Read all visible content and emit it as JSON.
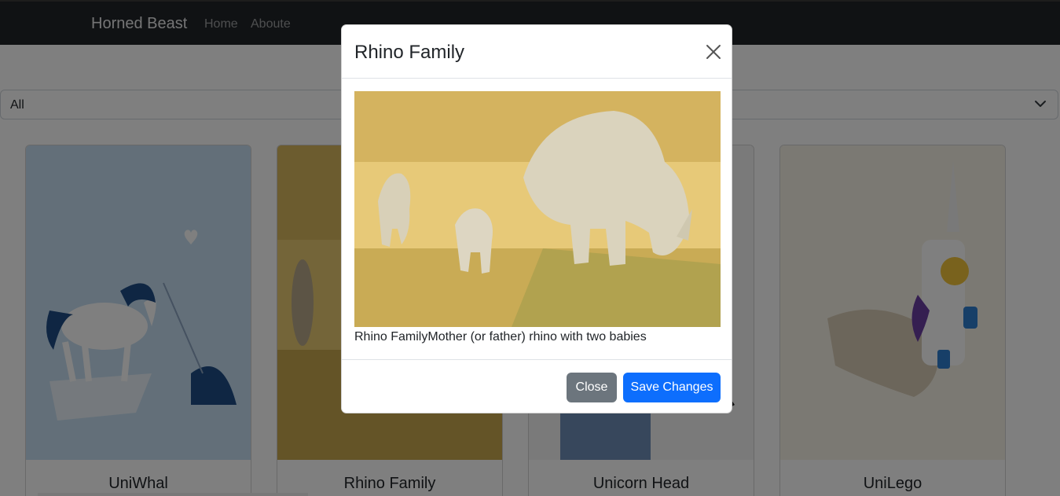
{
  "navbar": {
    "brand": "Horned Beast",
    "links": [
      "Home",
      "Aboute"
    ]
  },
  "filter": {
    "selected": "All"
  },
  "cards": [
    {
      "title": "UniWhal"
    },
    {
      "title": "Rhino Family"
    },
    {
      "title": "Unicorn Head"
    },
    {
      "title": "UniLego"
    }
  ],
  "modal": {
    "title": "Rhino Family",
    "description": "Rhino FamilyMother (or father) rhino with two babies",
    "close_label": "Close",
    "save_label": "Save Changes"
  },
  "colors": {
    "navbar_bg": "#212529",
    "primary": "#0d6efd",
    "secondary": "#6c757d"
  }
}
